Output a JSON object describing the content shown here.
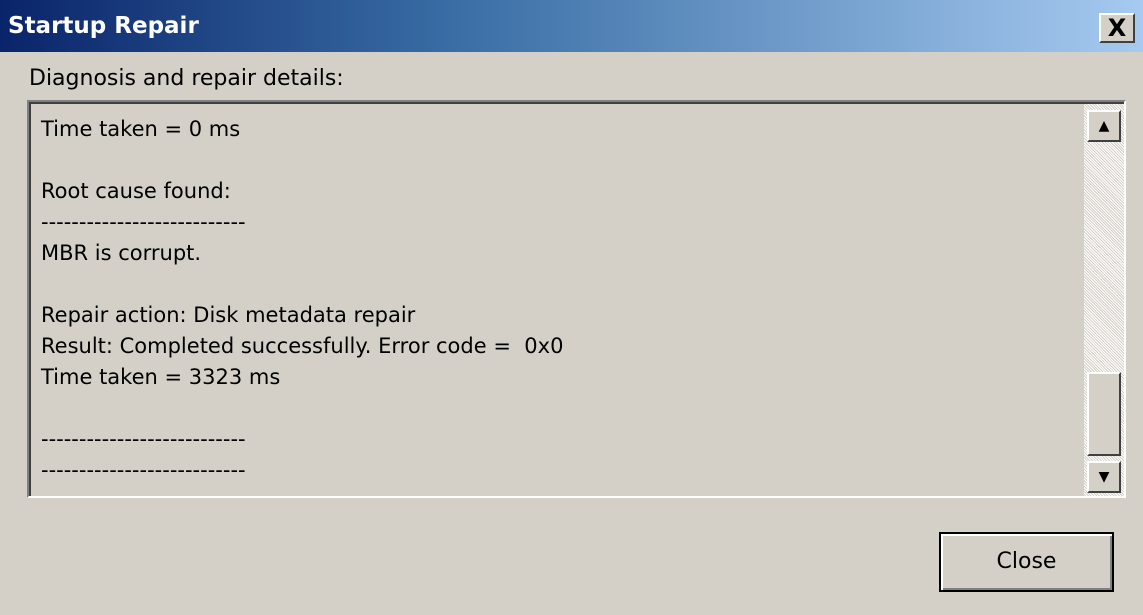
{
  "window": {
    "title": "Startup Repair",
    "close_glyph": "X"
  },
  "section_label": "Diagnosis and repair details:",
  "details": {
    "lines": [
      "Time taken = 0 ms",
      "",
      "Root cause found:",
      "---------------------------",
      "MBR is corrupt.",
      "",
      "Repair action: Disk metadata repair",
      "Result: Completed successfully. Error code =  0x0",
      "Time taken = 3323 ms",
      "",
      "---------------------------",
      "---------------------------"
    ]
  },
  "scrollbar": {
    "up_icon": "scroll-up-arrow-icon",
    "down_icon": "scroll-down-arrow-icon",
    "up_glyph": "▲",
    "down_glyph": "▼"
  },
  "footer": {
    "close_label": "Close"
  },
  "colors": {
    "titlebar_start": "#0a246a",
    "titlebar_end": "#a6caf0",
    "face": "#d4d0c8"
  }
}
